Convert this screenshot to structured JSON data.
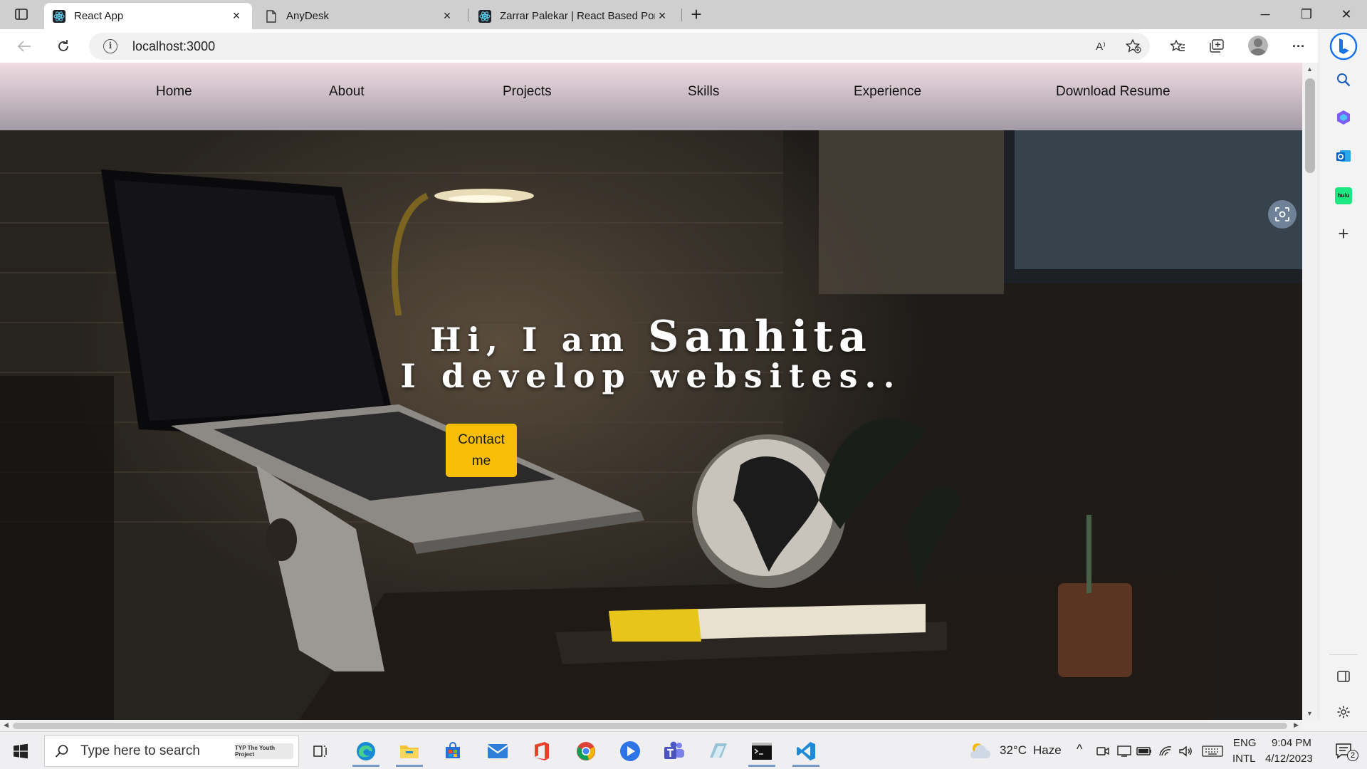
{
  "browser": {
    "tabs": [
      {
        "title": "React App",
        "favicon": "react-icon",
        "active": true
      },
      {
        "title": "AnyDesk",
        "favicon": "page-icon",
        "active": false
      },
      {
        "title": "Zarrar Palekar | React Based Portf",
        "favicon": "react-icon",
        "active": false
      }
    ],
    "new_tab": "+",
    "close": "×",
    "window_controls": {
      "minimize": "─",
      "maximize": "❐",
      "close": "✕"
    },
    "address": "localhost:3000",
    "icons": [
      "tab-actions-icon",
      "back-icon",
      "refresh-icon",
      "info-icon",
      "read-aloud-icon",
      "add-favorite-icon",
      "favorites-icon",
      "collections-icon",
      "profile-icon",
      "more-icon"
    ],
    "read_aloud_label": "A⁾",
    "more": "···"
  },
  "sidebar": {
    "items": [
      "bing-icon",
      "search-icon",
      "copilot-icon",
      "outlook-icon",
      "hulu-icon",
      "add-icon",
      "split-screen-icon",
      "settings-icon"
    ],
    "hulu_label": "hulu",
    "add_label": "+"
  },
  "site": {
    "nav": [
      "Home",
      "About",
      "Projects",
      "Skills",
      "Experience",
      "Download Resume"
    ],
    "hero": {
      "line1_prefix": "Hi, I am",
      "name": "Sanhita",
      "line2": "I develop websites..",
      "cta": "Contact me"
    }
  },
  "taskbar": {
    "search_placeholder": "Type here to search",
    "search_badge": "TYP The Youth Project",
    "apps": [
      "start-icon",
      "task-view-icon",
      "edge-icon",
      "file-explorer-icon",
      "store-icon",
      "mail-icon",
      "office-icon",
      "chrome-icon",
      "video-icon",
      "teams-icon",
      "anydesk-icon",
      "terminal-icon",
      "vscode-icon"
    ],
    "weather": {
      "temp": "32°C",
      "condition": "Haze"
    },
    "language": {
      "lang": "ENG",
      "layout": "INTL"
    },
    "clock": {
      "time": "9:04 PM",
      "date": "4/12/2023"
    },
    "notifications": "2",
    "chevron": "^"
  },
  "colors": {
    "accent": "#f8bd06",
    "nav_top": "#f1dde3",
    "nav_bottom": "#a29aa5",
    "taskbar": "#efeef0"
  }
}
